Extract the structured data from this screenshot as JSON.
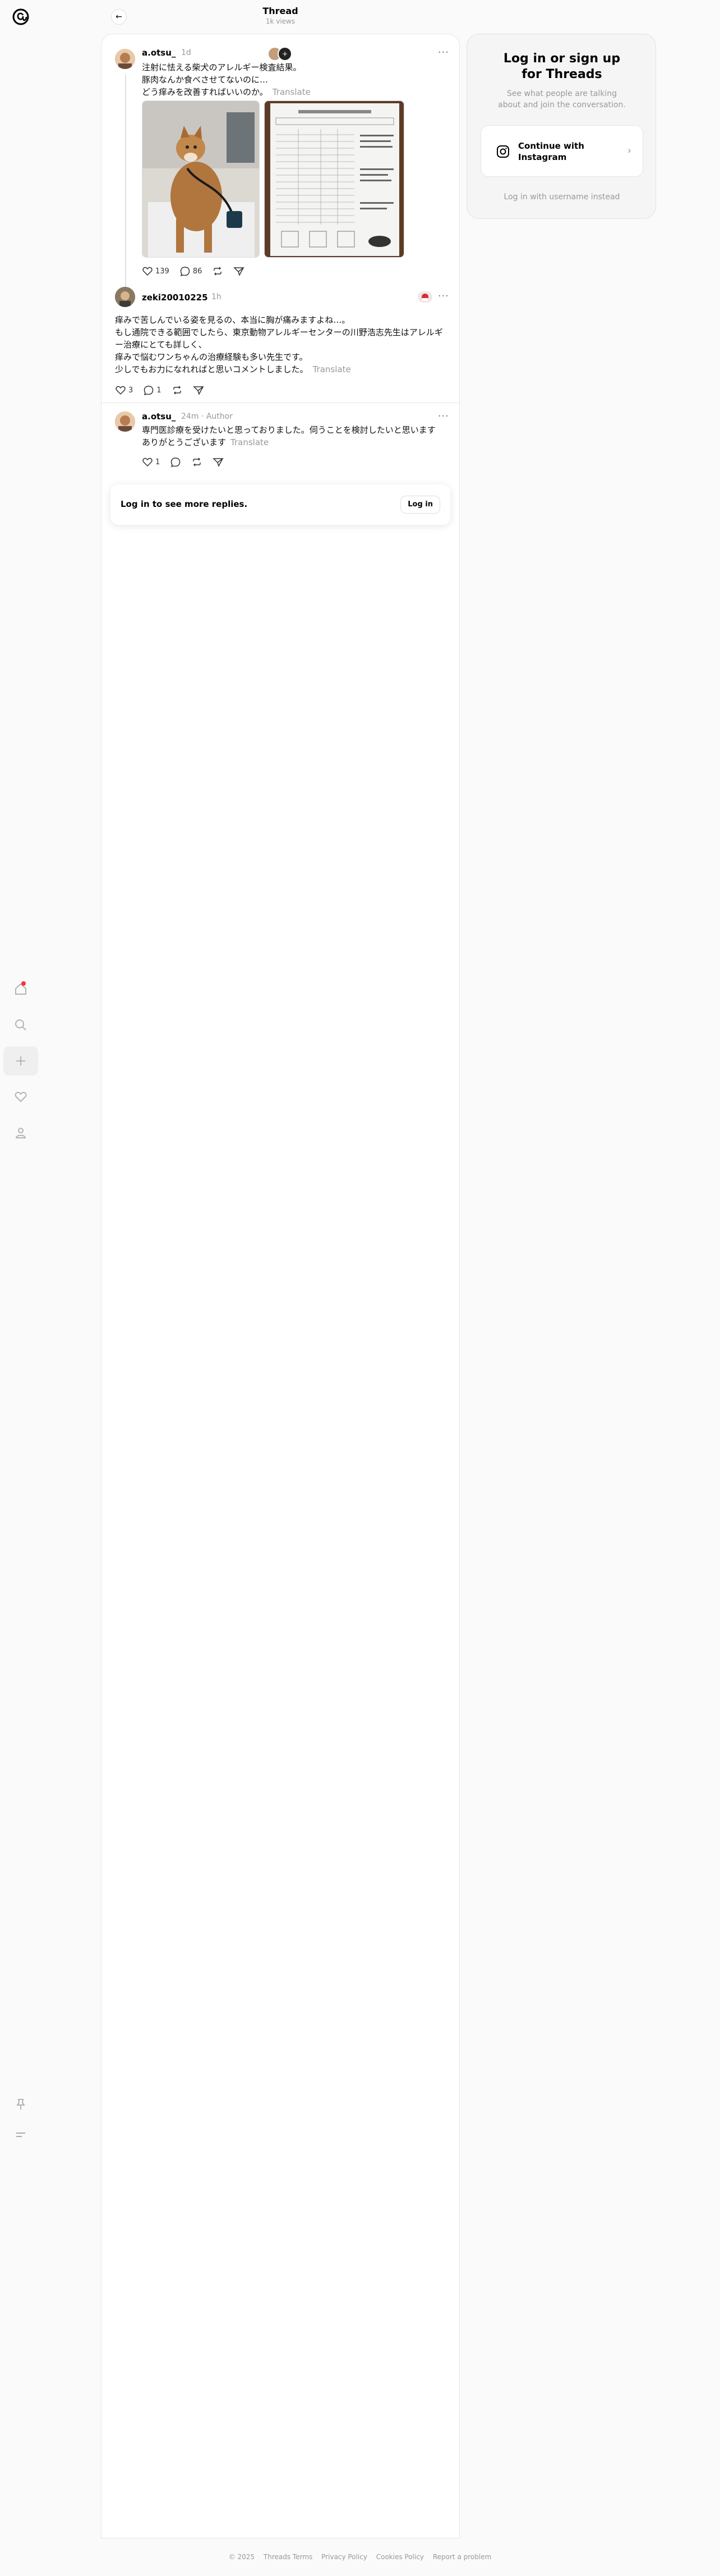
{
  "header": {
    "title": "Thread",
    "views": "1k views"
  },
  "post1": {
    "username": "a.otsu_",
    "time": "1d",
    "lines": [
      "注射に怯える柴犬のアレルギー検査結果。",
      "豚肉なんか食べさせてないのに…",
      "どう痒みを改善すればいいのか。"
    ],
    "translate": "Translate",
    "likes": "139",
    "replies": "86"
  },
  "post2": {
    "username": "zeki20010225",
    "time": "1h",
    "lines": [
      "痒みで苦しんでいる姿を見るの、本当に胸が痛みますよね…。",
      "もし通院できる範囲でしたら、東京動物アレルギーセンターの川野浩志先生はアレルギ",
      "ー治療にとても詳しく、",
      "痒みで悩むワンちゃんの治療経験も多い先生です。",
      "少しでもお力になれればと思いコメントしました。"
    ],
    "translate": "Translate",
    "likes": "3",
    "replies": "1"
  },
  "post3": {
    "username": "a.otsu_",
    "time": "24m",
    "author_tag": "Author",
    "lines": [
      "専門医診療を受けたいと思っておりました。伺うことを検討したいと思います",
      "ありがとうございます"
    ],
    "translate": "Translate",
    "likes": "1"
  },
  "login_more": {
    "text": "Log in to see more replies.",
    "button": "Log in"
  },
  "login_card": {
    "title": "Log in or sign up for Threads",
    "subtitle": "See what people are talking about and join the conversation.",
    "instagram_button": "Continue with Instagram",
    "alt_link": "Log in with username instead"
  },
  "footer": [
    "© 2025",
    "Threads Terms",
    "Privacy Policy",
    "Cookies Policy",
    "Report a problem"
  ],
  "colors": {
    "accent_dot": "#ff3040",
    "muted": "#999999"
  },
  "icons": [
    "threads-logo",
    "home-icon",
    "search-icon",
    "plus-icon",
    "heart-icon",
    "profile-icon",
    "pin-icon",
    "menu-icon",
    "instagram-icon"
  ]
}
